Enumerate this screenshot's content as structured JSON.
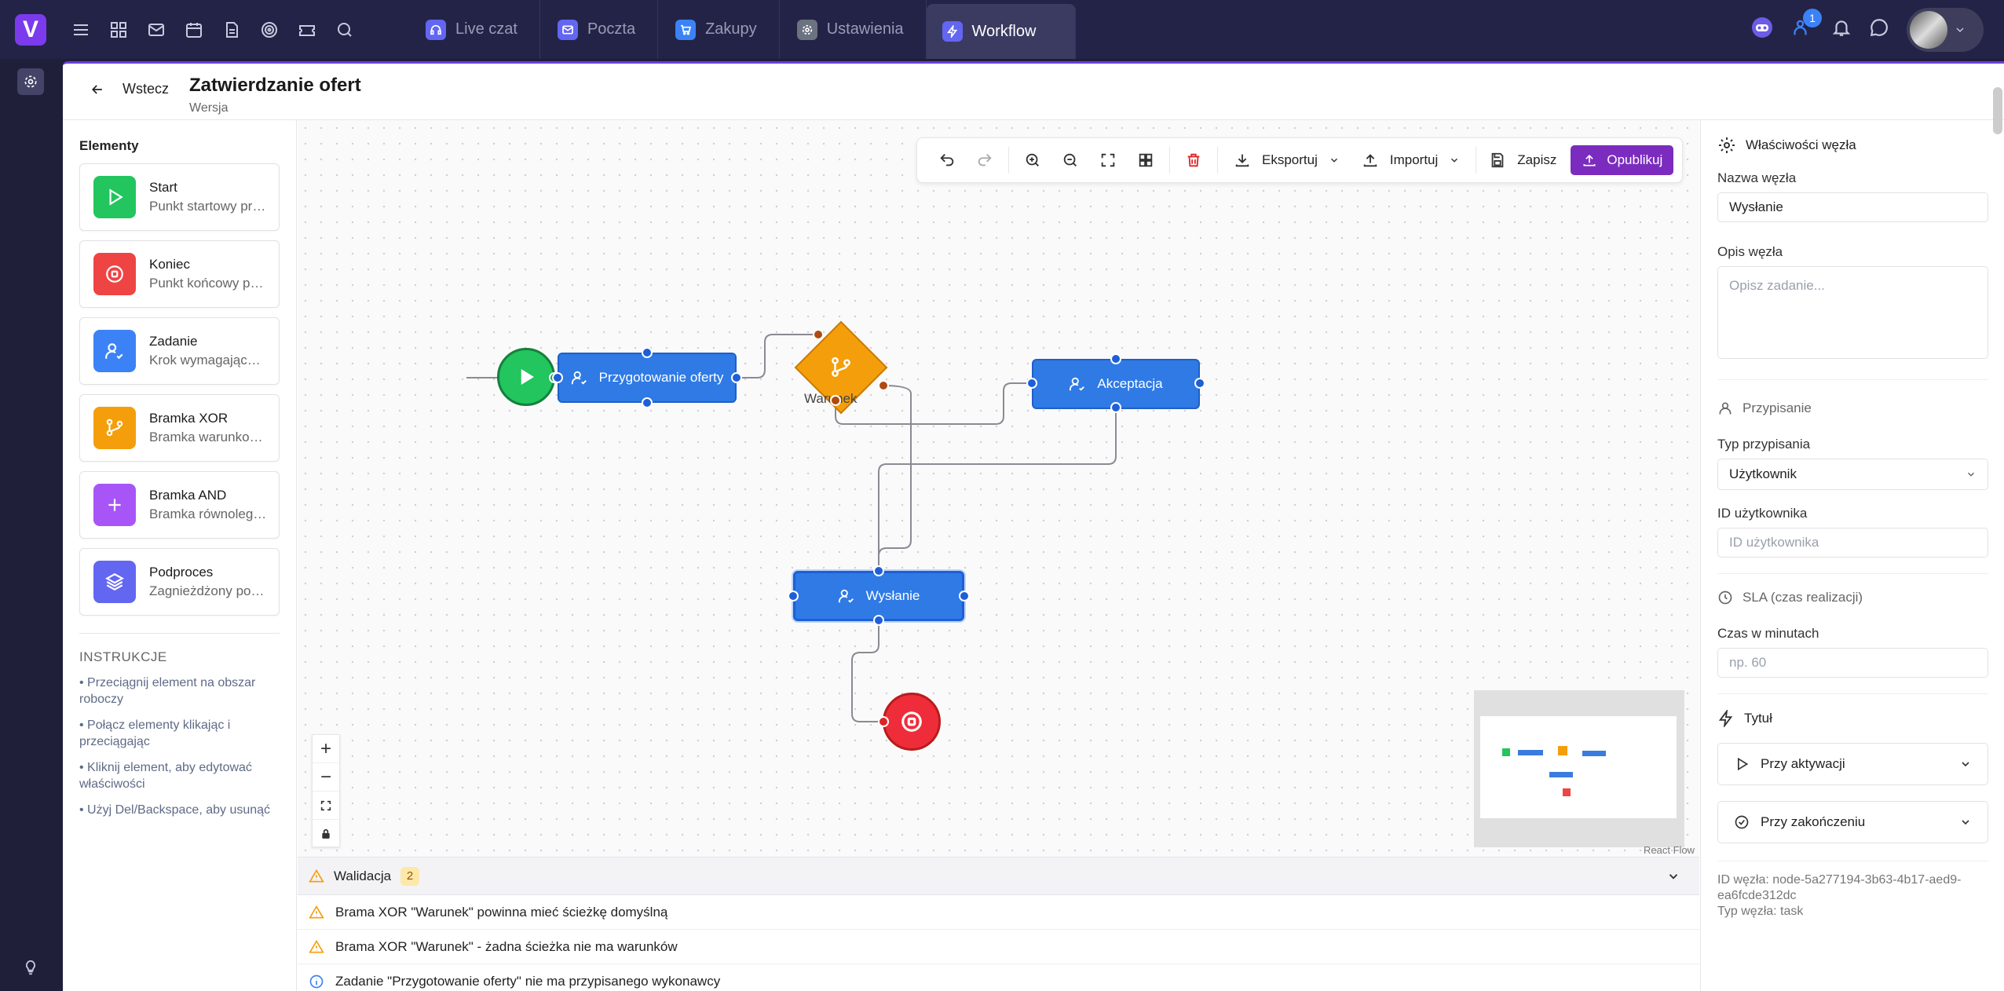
{
  "app": {
    "logo": "V"
  },
  "top_icons": [
    "menu-icon",
    "grid-icon",
    "mail-icon",
    "calendar-icon",
    "document-icon",
    "target-icon",
    "ticket-icon",
    "search-icon"
  ],
  "tabs": [
    {
      "label": "Live czat",
      "color": "#6366f1"
    },
    {
      "label": "Poczta",
      "color": "#6366f1"
    },
    {
      "label": "Zakupy",
      "color": "#3b82f6"
    },
    {
      "label": "Ustawienia",
      "color": "#6b7280"
    },
    {
      "label": "Workflow",
      "color": "#6366f1"
    }
  ],
  "notifications": {
    "count": "1"
  },
  "header": {
    "back": "Wstecz",
    "title": "Zatwierdzanie ofert",
    "subtitle": "Wersja"
  },
  "elements": {
    "title": "Elementy",
    "items": [
      {
        "name": "Start",
        "desc": "Punkt startowy procesu",
        "color": "#22c55e"
      },
      {
        "name": "Koniec",
        "desc": "Punkt końcowy procesu",
        "color": "#ef4444"
      },
      {
        "name": "Zadanie",
        "desc": "Krok wymagający działania",
        "color": "#3b82f6"
      },
      {
        "name": "Bramka XOR",
        "desc": "Bramka warunkowa XOR",
        "color": "#f59e0b"
      },
      {
        "name": "Bramka AND",
        "desc": "Bramka równoległa AND",
        "color": "#a855f7"
      },
      {
        "name": "Podproces",
        "desc": "Zagnieżdżony podproces",
        "color": "#6366f1"
      }
    ],
    "instructions_title": "INSTRUKCJE",
    "instructions": [
      "• Przeciągnij element na obszar roboczy",
      "• Połącz elementy klikając i przeciągając",
      "• Kliknij element, aby edytować właściwości",
      "• Użyj Del/Backspace, aby usunąć"
    ]
  },
  "toolbar": {
    "export": "Eksportuj",
    "import": "Importuj",
    "save": "Zapisz",
    "publish": "Opublikuj"
  },
  "flow": {
    "nodes": {
      "prep": "Przygotowanie oferty",
      "accept": "Akceptacja",
      "send": "Wysłanie",
      "condition": "Warunek"
    },
    "react_flow": "React Flow"
  },
  "validation": {
    "title": "Walidacja",
    "count": "2",
    "items": [
      {
        "type": "warning",
        "text": "Brama XOR \"Warunek\" powinna mieć ścieżkę domyślną"
      },
      {
        "type": "warning",
        "text": "Brama XOR \"Warunek\" - żadna ścieżka nie ma warunków"
      },
      {
        "type": "info",
        "text": "Zadanie \"Przygotowanie oferty\" nie ma przypisanego wykonawcy"
      }
    ]
  },
  "props": {
    "title": "Właściwości węzła",
    "name_label": "Nazwa węzła",
    "name_value": "Wysłanie",
    "desc_label": "Opis węzła",
    "desc_placeholder": "Opisz zadanie...",
    "assign_section": "Przypisanie",
    "assign_type_label": "Typ przypisania",
    "assign_type_value": "Użytkownik",
    "user_id_label": "ID użytkownika",
    "user_id_placeholder": "ID użytkownika",
    "sla_section": "SLA (czas realizacji)",
    "time_label": "Czas w minutach",
    "time_placeholder": "np. 60",
    "trigger_section": "Tytuł",
    "on_activate": "Przy aktywacji",
    "on_complete": "Przy zakończeniu",
    "node_id": "ID węzła: node-5a277194-3b63-4b17-aed9-ea6fcde312dc",
    "node_type": "Typ węzła: task"
  }
}
